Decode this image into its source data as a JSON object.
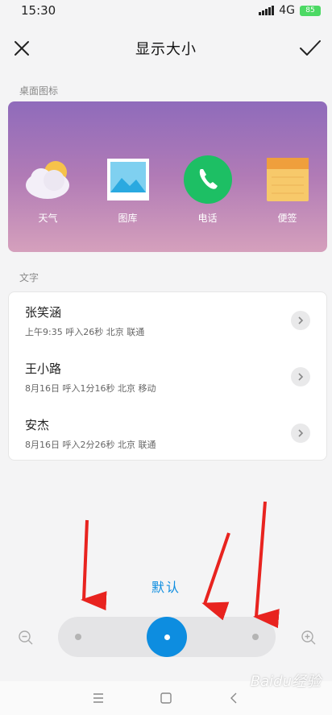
{
  "status_bar": {
    "time": "15:30",
    "network": "4G",
    "battery": "85"
  },
  "header": {
    "title": "显示大小"
  },
  "sections": {
    "icons_label": "桌面图标",
    "text_label": "文字"
  },
  "apps": [
    {
      "label": "天气",
      "icon": "weather-icon"
    },
    {
      "label": "图库",
      "icon": "gallery-icon"
    },
    {
      "label": "电话",
      "icon": "phone-icon"
    },
    {
      "label": "便签",
      "icon": "notes-icon"
    }
  ],
  "contacts": [
    {
      "name": "张笑涵",
      "detail": "上午9:35 呼入26秒 北京 联通"
    },
    {
      "name": "王小路",
      "detail": "8月16日 呼入1分16秒 北京 移动"
    },
    {
      "name": "安杰",
      "detail": "8月16日 呼入2分26秒 北京 联通"
    }
  ],
  "size_control": {
    "label": "默认",
    "steps": 3,
    "selected_step": 2
  },
  "colors": {
    "accent": "#0d8de0",
    "panel_top": "#8f6bbb",
    "panel_bottom": "#d5a0bc",
    "annotation": "#e8231f"
  },
  "watermark": "Baidu经验"
}
